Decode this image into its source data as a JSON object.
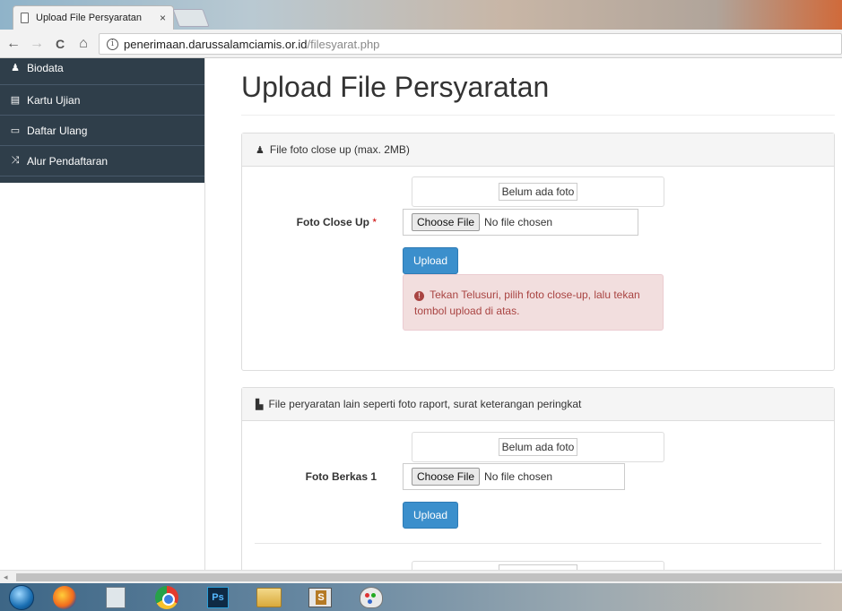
{
  "browser": {
    "tab_title": "Upload File Persyaratan",
    "tab_close": "×",
    "url_host": "penerimaan.darussalamciamis.or.id",
    "url_path": "/filesyarat.php",
    "info_glyph": "i",
    "back_glyph": "←",
    "forward_glyph": "→",
    "reload_glyph": "C",
    "home_glyph": "⌂"
  },
  "sidebar": {
    "items": [
      {
        "label": "Biodata",
        "icon": "user-icon",
        "glyph": "♟"
      },
      {
        "label": "Kartu Ujian",
        "icon": "id-card-icon",
        "glyph": "▤"
      },
      {
        "label": "Daftar Ulang",
        "icon": "credit-card-icon",
        "glyph": "▭"
      },
      {
        "label": "Alur Pendaftaran",
        "icon": "random-icon",
        "glyph": "⤨"
      }
    ],
    "bg_color": "#2f3e4a"
  },
  "page": {
    "title": "Upload File Persyaratan"
  },
  "panel1": {
    "heading": "File foto close up (max. 2MB)",
    "heading_icon": "user-icon",
    "heading_glyph": "♟",
    "preview_text": "Belum ada foto",
    "label": "Foto Close Up",
    "required_mark": "*",
    "choose_label": "Choose File",
    "no_file": "No file chosen",
    "upload_label": "Upload",
    "alert_glyph": "!",
    "alert_text": "Tekan Telusuri, pilih foto close-up, lalu tekan tombol upload di atas."
  },
  "panel2": {
    "heading": "File peryaratan lain seperti foto raport, surat keterangan peringkat",
    "heading_icon": "file-icon",
    "heading_glyph": "▙",
    "preview_text": "Belum ada foto",
    "label": "Foto Berkas 1",
    "choose_label": "Choose File",
    "no_file": "No file chosen",
    "upload_label": "Upload"
  },
  "scrollbar": {
    "left_arrow": "◂"
  },
  "taskbar": {
    "ps_label": "Ps",
    "apps": [
      "windows-start-icon",
      "firefox-icon",
      "calculator-icon",
      "chrome-icon",
      "photoshop-icon",
      "file-explorer-icon",
      "app-s-icon",
      "paint-icon"
    ]
  },
  "colors": {
    "accent": "#3b8fcc",
    "alert_bg": "#f2dede",
    "alert_text": "#a94442"
  }
}
